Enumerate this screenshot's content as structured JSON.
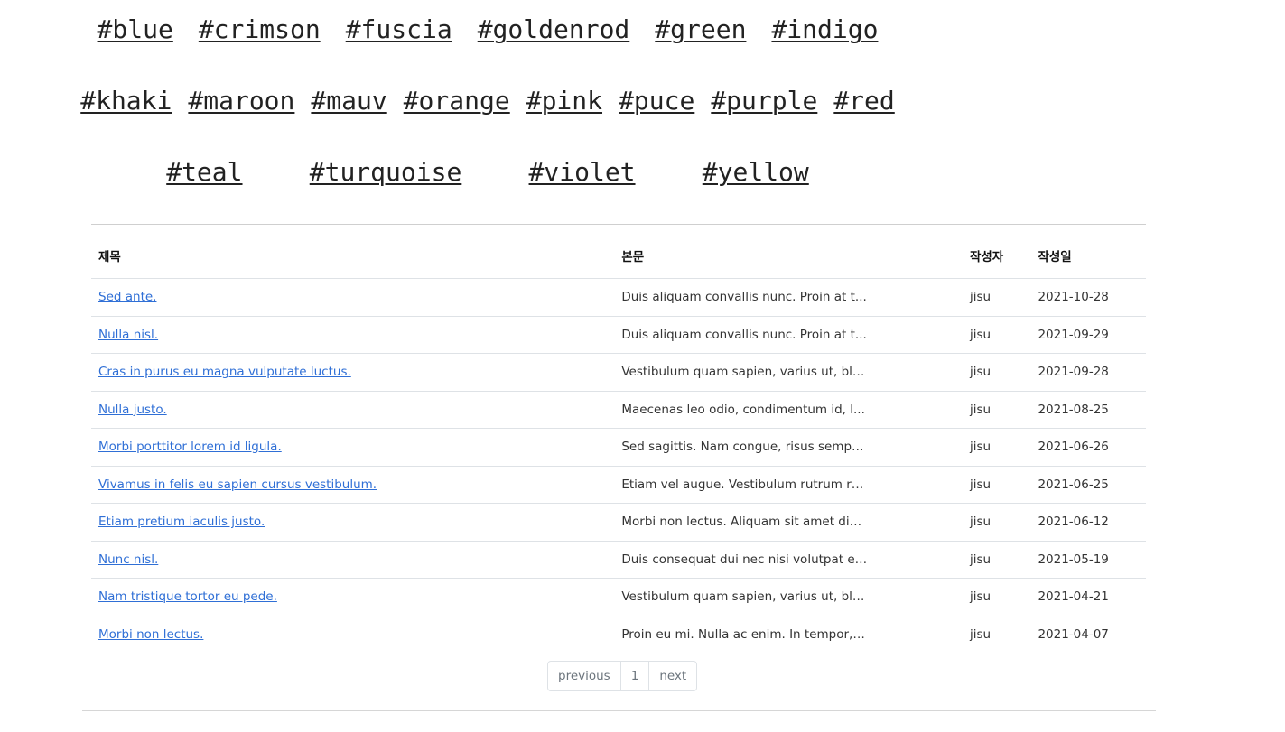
{
  "tags": {
    "row1": [
      "#blue",
      "#crimson",
      "#fuscia",
      "#goldenrod",
      "#green",
      "#indigo"
    ],
    "row2": [
      "#khaki",
      "#maroon",
      "#mauv",
      "#orange",
      "#pink",
      "#puce",
      "#purple",
      "#red"
    ],
    "row3": [
      "#teal",
      "#turquoise",
      "#violet",
      "#yellow"
    ]
  },
  "table": {
    "headers": {
      "title": "제목",
      "body": "본문",
      "author": "작성자",
      "date": "작성일"
    },
    "rows": [
      {
        "title": "Sed ante.",
        "body": "Duis aliquam convallis nunc. Proin at t...",
        "author": "jisu",
        "date": "2021-10-28"
      },
      {
        "title": "Nulla nisl.",
        "body": "Duis aliquam convallis nunc. Proin at t...",
        "author": "jisu",
        "date": "2021-09-29"
      },
      {
        "title": "Cras in purus eu magna vulputate luctus.",
        "body": "Vestibulum quam sapien, varius ut, bla...",
        "author": "jisu",
        "date": "2021-09-28"
      },
      {
        "title": "Nulla justo.",
        "body": "Maecenas leo odio, condimentum id, l...",
        "author": "jisu",
        "date": "2021-08-25"
      },
      {
        "title": "Morbi porttitor lorem id ligula.",
        "body": "Sed sagittis. Nam congue, risus semper...",
        "author": "jisu",
        "date": "2021-06-26"
      },
      {
        "title": "Vivamus in felis eu sapien cursus vestibulum.",
        "body": "Etiam vel augue. Vestibulum rutrum rut...",
        "author": "jisu",
        "date": "2021-06-25"
      },
      {
        "title": "Etiam pretium iaculis justo.",
        "body": "Morbi non lectus. Aliquam sit amet dia...",
        "author": "jisu",
        "date": "2021-06-12"
      },
      {
        "title": "Nunc nisl.",
        "body": "Duis consequat dui nec nisi volutpat el...",
        "author": "jisu",
        "date": "2021-05-19"
      },
      {
        "title": "Nam tristique tortor eu pede.",
        "body": "Vestibulum quam sapien, varius ut, bla...",
        "author": "jisu",
        "date": "2021-04-21"
      },
      {
        "title": "Morbi non lectus.",
        "body": "Proin eu mi. Nulla ac enim. In tempor, ...",
        "author": "jisu",
        "date": "2021-04-07"
      }
    ]
  },
  "pagination": {
    "previous": "previous",
    "page": "1",
    "next": "next"
  },
  "colors": {
    "link": "#2f6fd6",
    "tag": "#222222",
    "border": "#dee2e6",
    "muted": "#6c757d"
  }
}
